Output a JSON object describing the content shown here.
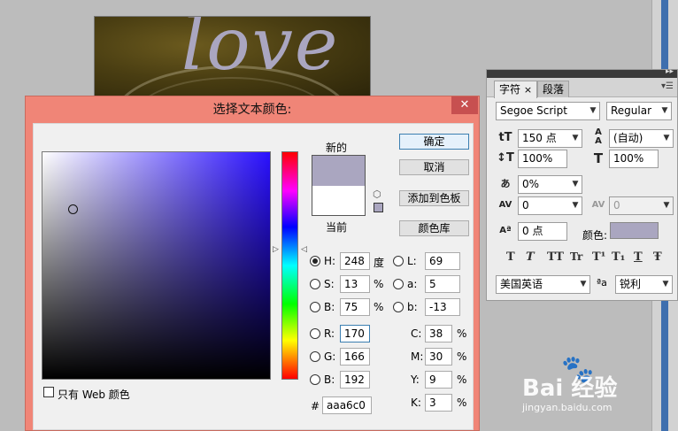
{
  "canvas": {
    "text": "love",
    "text_color": "#aaa6c0"
  },
  "character_panel": {
    "tabs": [
      "字符",
      "段落"
    ],
    "tab_close": "×",
    "font_family": "Segoe Script",
    "font_style": "Regular",
    "font_size": "150 点",
    "leading": "(自动)",
    "vertical_scale": "100%",
    "horizontal_scale": "100%",
    "tsume": "0%",
    "kerning": "0",
    "tracking": "0",
    "baseline_shift": "0 点",
    "color_label": "颜色:",
    "color_value": "#aaa6c0",
    "format_buttons": [
      "T",
      "T",
      "TT",
      "Tr",
      "T¹",
      "T₁",
      "T",
      "Ŧ"
    ],
    "language": "美国英语",
    "aa_icon": "ªa",
    "anti_alias": "锐利"
  },
  "dialog": {
    "title": "选择文本颜色:",
    "close": "✕",
    "new_label": "新的",
    "current_label": "当前",
    "new_color": "#aaa6c0",
    "current_color": "#ffffff",
    "buttons": {
      "ok": "确定",
      "cancel": "取消",
      "add_swatch": "添加到色板",
      "libraries": "颜色库"
    },
    "hsb": [
      {
        "label": "H:",
        "value": "248",
        "unit": "度",
        "selected": true
      },
      {
        "label": "S:",
        "value": "13",
        "unit": "%",
        "selected": false
      },
      {
        "label": "B:",
        "value": "75",
        "unit": "%",
        "selected": false
      }
    ],
    "lab": [
      {
        "label": "L:",
        "value": "69"
      },
      {
        "label": "a:",
        "value": "5"
      },
      {
        "label": "b:",
        "value": "-13"
      }
    ],
    "rgb": [
      {
        "label": "R:",
        "value": "170"
      },
      {
        "label": "G:",
        "value": "166"
      },
      {
        "label": "B:",
        "value": "192"
      }
    ],
    "cmyk": [
      {
        "label": "C:",
        "value": "38",
        "unit": "%"
      },
      {
        "label": "M:",
        "value": "30",
        "unit": "%"
      },
      {
        "label": "Y:",
        "value": "9",
        "unit": "%"
      },
      {
        "label": "K:",
        "value": "3",
        "unit": "%"
      }
    ],
    "hex_label": "#",
    "hex_value": "aaa6c0",
    "web_only": "只有 Web 颜色"
  },
  "watermark": {
    "brand": "Bai 经验",
    "url": "jingyan.baidu.com"
  }
}
